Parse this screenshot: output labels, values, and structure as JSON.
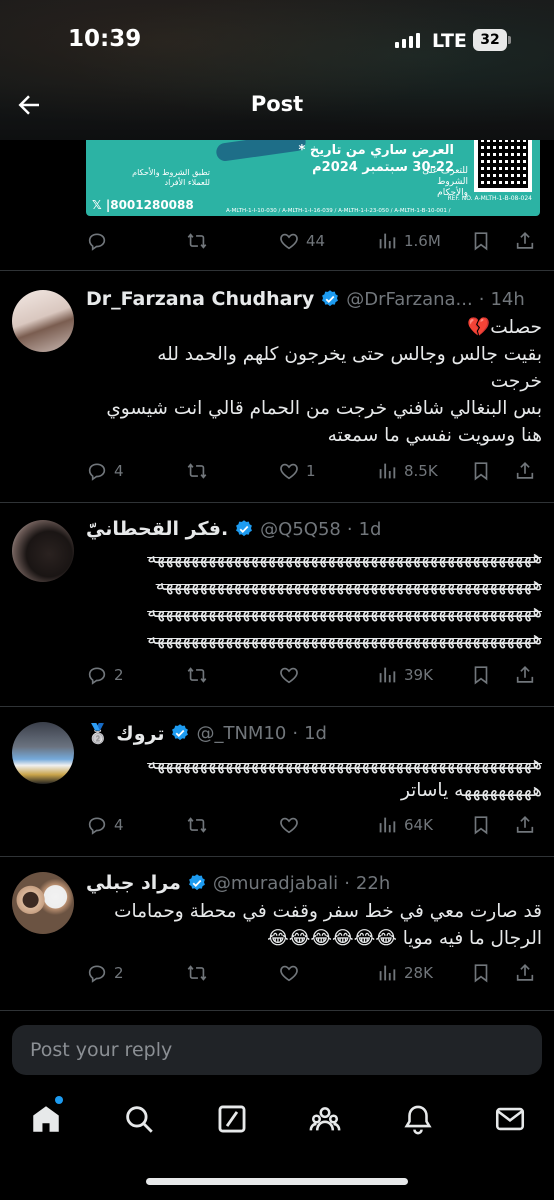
{
  "status_bar": {
    "time": "10:39",
    "network": "LTE",
    "battery": "32"
  },
  "header": {
    "title": "Post"
  },
  "promo": {
    "offer": "* العرض ساري من تاريخ 22-30 سبتمبر 2024م",
    "learn_more": "للتعرف على الشروط والأحكام",
    "terms_app": "تطبق الشروط والأحكام للعملاء الأفراد",
    "phone": "𝕏 |8001280088",
    "ref_no": "REF. NO. A-MLTH-1-B-08-024",
    "reg_line": "A-MLTH-1-I-10-030 / A-MLTH-1-I-16-039 / A-MLTH-1-I-23-050 / A-MLTH-1-B-10-001 /"
  },
  "main_actions": {
    "replies": "",
    "retweets": "",
    "likes": "44",
    "views": "1.6M"
  },
  "tweets": [
    {
      "name": "Dr_Farzana Chudhary",
      "handle": "@DrFarzana...",
      "time": "14h",
      "lines": [
        "حصلت💔",
        "بقيت جالس وجالس حتى يخرجون كلهم والحمد لله",
        "خرجت",
        "بس البنغالي شافني خرجت من الحمام قالي انت شيسوي",
        "هنا وسويت نفسي ما سمعته"
      ],
      "replies": "4",
      "retweets": "",
      "likes": "1",
      "views": "8.5K"
    },
    {
      "name": "فكر القحطانيّ.",
      "handle": "@Q5Q58",
      "time": "1d",
      "lines": [
        "هههههههههههههههههههههههههههههههههههههههههههههه",
        "ههههههههههههههههههههههههههههههههههههههههههههه",
        "هههههههههههههههههههههههههههههههههههههههههههههه",
        "هههههههههههههههههههههههههههههههههههههههههههههه"
      ],
      "replies": "2",
      "retweets": "",
      "likes": "",
      "views": "39K"
    },
    {
      "name": "🥈 تروك",
      "handle": "@_TNM10",
      "time": "1d",
      "lines": [
        "هههههههههههههههههههههههههههههههههههههههههههههه",
        "هههههههههه ياساتر"
      ],
      "replies": "4",
      "retweets": "",
      "likes": "",
      "views": "64K"
    },
    {
      "name": "مراد جبلي",
      "handle": "@muradjabali",
      "time": "22h",
      "lines": [
        "قد صارت معي في خط سفر وقفت في محطة وحمامات",
        "الرجال ما فيه مويا 😂😂😂😂😂😂"
      ],
      "replies": "2",
      "retweets": "",
      "likes": "",
      "views": "28K"
    }
  ],
  "reply_bar": {
    "placeholder": "Post your reply"
  },
  "colors": {
    "accent": "#1d9bf0",
    "muted": "#71767b",
    "promo_bg": "#2cb3a4",
    "background": "#000000"
  },
  "tabs": [
    "home-icon",
    "search-icon",
    "grok-icon",
    "communities-icon",
    "notifications-icon",
    "messages-icon"
  ]
}
